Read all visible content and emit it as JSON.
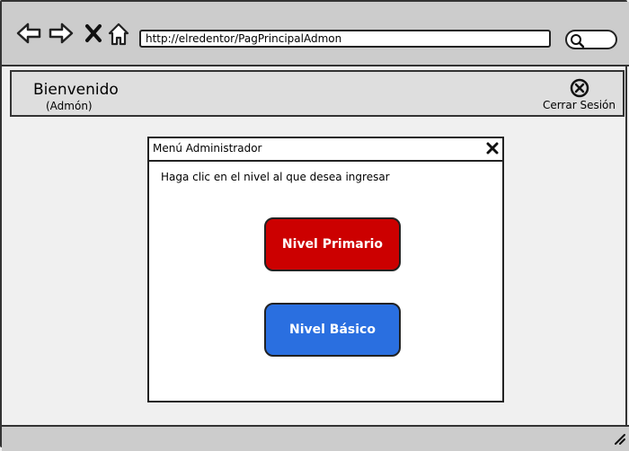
{
  "browser": {
    "url": "http://elredentor/PagPrincipalAdmon",
    "icons": [
      "back-icon",
      "forward-icon",
      "stop-icon",
      "home-icon",
      "search-icon"
    ]
  },
  "header": {
    "welcome": "Bienvenido",
    "role": "(Admón)",
    "logout_label": "Cerrar Sesión",
    "logout_icon": "close-circle-icon"
  },
  "dialog": {
    "title": "Menú Administrador",
    "instruction": "Haga clic en el nivel al que desea ingresar",
    "buttons": [
      {
        "label": "Nivel Primario",
        "color": "#cc0000"
      },
      {
        "label": "Nivel Básico",
        "color": "#2a6fe0"
      }
    ]
  },
  "colors": {
    "toolbar": "#cccccc",
    "page": "#f0f0f0",
    "header_panel": "#dedede"
  }
}
